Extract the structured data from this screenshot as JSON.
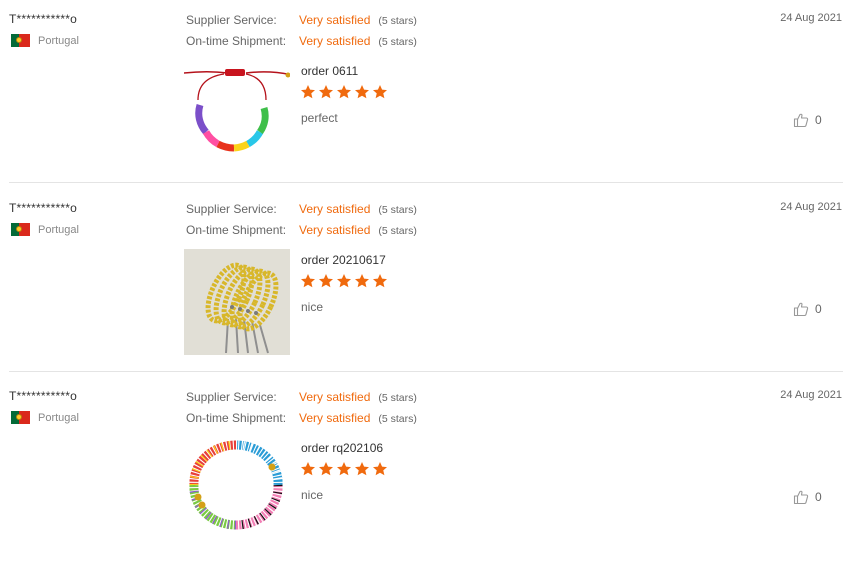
{
  "colors": {
    "accent": "#f06a0e",
    "divider": "#e4e4e4"
  },
  "reviews": [
    {
      "reviewer": "T***********o",
      "country": "Portugal",
      "supplier_label": "Supplier Service:",
      "supplier_value": "Very satisfied",
      "supplier_count": "(5 stars)",
      "shipment_label": "On-time Shipment:",
      "shipment_value": "Very satisfied",
      "shipment_count": "(5 stars)",
      "date": "24 Aug 2021",
      "order": "order 0611",
      "stars": 5,
      "comment": "perfect",
      "helpful": "0",
      "photo_icon": "rainbow-bead-bracelet-photo"
    },
    {
      "reviewer": "T***********o",
      "country": "Portugal",
      "supplier_label": "Supplier Service:",
      "supplier_value": "Very satisfied",
      "supplier_count": "(5 stars)",
      "shipment_label": "On-time Shipment:",
      "shipment_value": "Very satisfied",
      "shipment_count": "(5 stars)",
      "date": "24 Aug 2021",
      "order": "order 20210617",
      "stars": 5,
      "comment": "nice",
      "helpful": "0",
      "photo_icon": "gold-bead-bracelets-photo"
    },
    {
      "reviewer": "T***********o",
      "country": "Portugal",
      "supplier_label": "Supplier Service:",
      "supplier_value": "Very satisfied",
      "supplier_count": "(5 stars)",
      "shipment_label": "On-time Shipment:",
      "shipment_value": "Very satisfied",
      "shipment_count": "(5 stars)",
      "date": "24 Aug 2021",
      "order": "order rq202106",
      "stars": 5,
      "comment": "nice",
      "helpful": "0",
      "photo_icon": "heishi-bracelet-photo"
    }
  ]
}
